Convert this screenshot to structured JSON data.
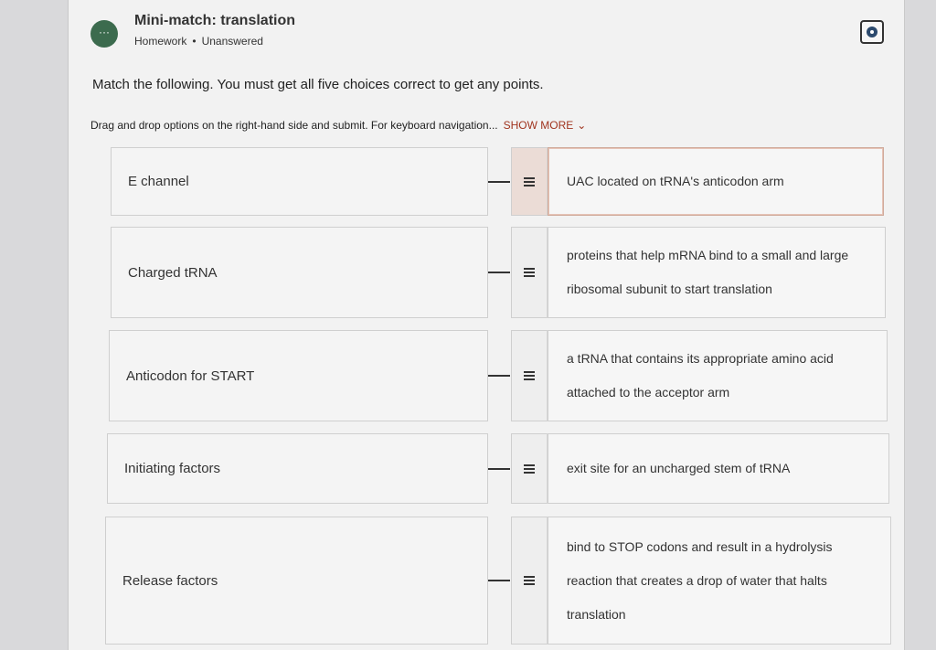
{
  "header": {
    "avatar_glyph": "···",
    "title": "Mini-match: translation",
    "type": "Homework",
    "separator": "•",
    "status": "Unanswered"
  },
  "question_text": "Match the following. You must get all five choices correct to get any points.",
  "instructions": {
    "text": "Drag and drop options on the right-hand side and submit. For keyboard navigation...",
    "show_more": "SHOW MORE",
    "chevron": "⌄"
  },
  "pairs": [
    {
      "term": "E channel",
      "option": "UAC located on tRNA's anticodon arm"
    },
    {
      "term": "Charged tRNA",
      "option": "proteins that help mRNA bind to a small and large ribosomal subunit to start translation"
    },
    {
      "term": "Anticodon for START",
      "option": "a tRNA that contains its appropriate amino acid attached to the acceptor arm"
    },
    {
      "term": "Initiating factors",
      "option": "exit site for an uncharged stem of tRNA"
    },
    {
      "term": "Release factors",
      "option": "bind to STOP codons and result in a hydrolysis reaction that creates a drop of water that halts translation"
    }
  ]
}
